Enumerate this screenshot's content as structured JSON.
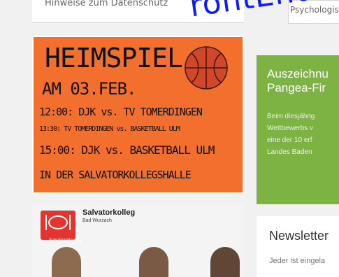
{
  "top_links": {
    "privacy": "Hinweise zum Datenschutz",
    "search_partial": "Psychologische"
  },
  "poster": {
    "line1": "HEIMSPIEL",
    "line2": "AM 03.FEB.",
    "line3": "12:00: DJK vs. TV TOMERDINGEN",
    "line4": "13:30: TV TOMERDINGEN vs. BASKETBALL ULM",
    "line5": "15:00: DJK vs. BASKETBALL ULM",
    "line6": "IN DER SALVATORKOLLEGSHALLE"
  },
  "photo": {
    "school_name": "Salvatorkolleg",
    "school_sub": "Bad Wurzach",
    "badge": "SchulVerpflegung"
  },
  "award": {
    "title_line1": "Auszeichnu",
    "title_line2": "Pangea-Fir",
    "body_line1": "Beim diesjährig",
    "body_line2": "Wettbewerbs v",
    "body_line3": "eine der 10 erf",
    "body_line4": "Landes Baden"
  },
  "newsletter": {
    "title": "Newsletter",
    "text": "Jeder ist eingela"
  },
  "watermark": "rontEnd",
  "colors": {
    "poster_orange": "#f36f2e",
    "award_green": "#7cb342",
    "watermark_blue": "#0a1bff",
    "ball": "#d2472a"
  }
}
